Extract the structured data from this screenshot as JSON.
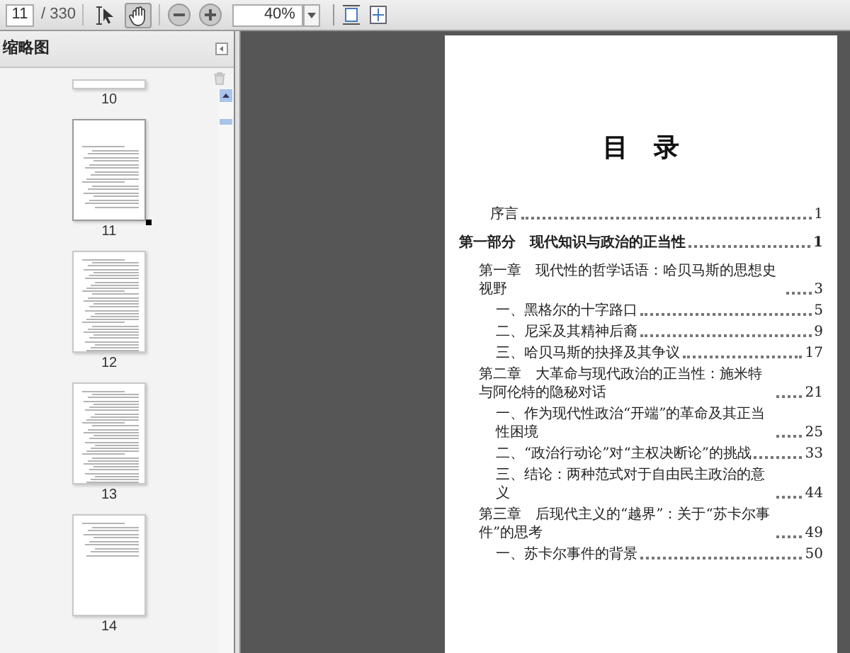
{
  "toolbar": {
    "page_number": "11",
    "page_count": "/ 330",
    "tools": [
      {
        "kind": "select",
        "selected": false
      },
      {
        "kind": "hand",
        "selected": true
      }
    ],
    "zoom": "40%"
  },
  "sidebar": {
    "title": "缩略图",
    "thumbnails": [
      {
        "label": "10",
        "selected": false,
        "kind": "partial"
      },
      {
        "label": "11",
        "selected": true,
        "kind": "toc"
      },
      {
        "label": "12",
        "selected": false,
        "kind": "dense"
      },
      {
        "label": "13",
        "selected": false,
        "kind": "dense"
      },
      {
        "label": "14",
        "selected": false,
        "kind": "short"
      }
    ]
  },
  "document": {
    "title": "目　录",
    "entries": [
      {
        "kind": "preface",
        "title": "序言",
        "page": "1"
      },
      {
        "kind": "part",
        "title": "第一部分　现代知识与政治的正当性",
        "page": "1"
      },
      {
        "kind": "chapter",
        "title": "第一章　现代性的哲学话语：哈贝马斯的思想史视野",
        "page": "3"
      },
      {
        "kind": "section",
        "title": "一、黑格尔的十字路口",
        "page": "5"
      },
      {
        "kind": "section",
        "title": "二、尼采及其精神后裔",
        "page": "9"
      },
      {
        "kind": "section",
        "title": "三、哈贝马斯的抉择及其争议",
        "page": "17"
      },
      {
        "kind": "chapter",
        "title": "第二章　大革命与现代政治的正当性：施米特与阿伦特的隐秘对话",
        "page": "21"
      },
      {
        "kind": "section",
        "title": "一、作为现代性政治“开端”的革命及其正当性困境",
        "page": "25"
      },
      {
        "kind": "section",
        "title": "二、“政治行动论”对“主权决断论”的挑战",
        "page": "33"
      },
      {
        "kind": "section",
        "title": "三、结论：两种范式对于自由民主政治的意义",
        "page": "44"
      },
      {
        "kind": "chapter",
        "title": "第三章　后现代主义的“越界”：关于“苏卡尔事件”的思考",
        "page": "49"
      },
      {
        "kind": "section",
        "title": "一、苏卡尔事件的背景",
        "page": "50"
      }
    ]
  }
}
